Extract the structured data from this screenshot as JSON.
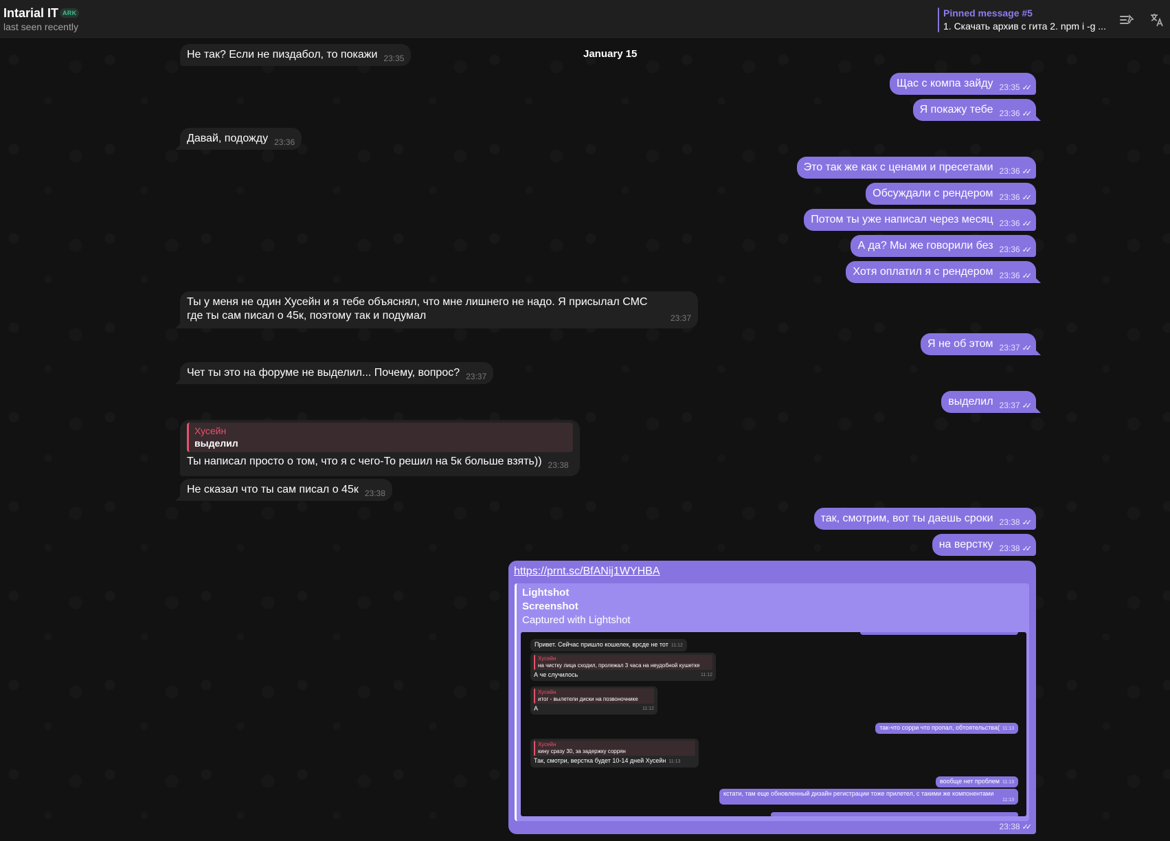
{
  "header": {
    "name": "Intarial IT",
    "badge": "ARK",
    "status": "last seen recently",
    "pinned_title": "Pinned message #5",
    "pinned_text": "1. Скачать архив с гита 2. npm i -g ..."
  },
  "date_separator": "January 15",
  "messages": {
    "m1": {
      "text": "Не так? Если не пиздабол, то покажи",
      "time": "23:35"
    },
    "m2": {
      "text": "Щас с компа зайду",
      "time": "23:35"
    },
    "m3": {
      "text": "Я покажу тебе",
      "time": "23:36"
    },
    "m4": {
      "text": "Давай, подожду",
      "time": "23:36"
    },
    "m5": {
      "text": "Это так же как с ценами и пресетами",
      "time": "23:36"
    },
    "m6": {
      "text": "Обсуждали с рендером",
      "time": "23:36"
    },
    "m7": {
      "text": "Потом ты уже написал через месяц",
      "time": "23:36"
    },
    "m8": {
      "text": "А да? Мы же говорили без",
      "time": "23:36"
    },
    "m9": {
      "text": "Хотя оплатил я с рендером",
      "time": "23:36"
    },
    "m10": {
      "text": "Ты у меня не один Хусейн и я тебе объяснял, что мне лишнего не надо. Я присылал СМС где ты сам писал о 45к, поэтому так и подумал",
      "time": "23:37"
    },
    "m11": {
      "text": "Я не об этом",
      "time": "23:37"
    },
    "m12": {
      "text": "Чет ты это на форуме не выделил... Почему, вопрос?",
      "time": "23:37"
    },
    "m13": {
      "text": "выделил",
      "time": "23:37"
    },
    "m14": {
      "reply_name": "Хусейн",
      "reply_text": "выделил",
      "text": "Ты написал просто о том, что я с чего-То решил на 5к больше взять))",
      "time": "23:38"
    },
    "m15": {
      "text": "Не сказал что ты сам писал о 45к",
      "time": "23:38"
    },
    "m16": {
      "text": "так, смотрим, вот ты даешь сроки",
      "time": "23:38"
    },
    "m17": {
      "text": "на верстку",
      "time": "23:38"
    }
  },
  "link_message": {
    "url": "https://prnt.sc/BfANij1WYHBA",
    "site": "Lightshot",
    "title": "Screenshot",
    "description": "Captured with Lightshot",
    "time": "23:38",
    "screenshot": {
      "s1": {
        "text": "Привет. Сейчас пришло кошелек, врсде не тот",
        "time": "11:12"
      },
      "s2": {
        "reply_name": "Хусейн",
        "reply_text": "на чистку лица сходил, пролежал 3 часа на неудобной кушетке",
        "text": "А че случилось",
        "time": "11:12"
      },
      "s3": {
        "reply_name": "Хусейн",
        "reply_text": "итог - вылетели диски на позвоночнике",
        "text": "А",
        "time": "11:12"
      },
      "s4": {
        "text": "так-что сорри что пропал, обтоятельства(",
        "time": "11:13"
      },
      "s5": {
        "reply_name": "Хусейн",
        "reply_text": "кину сразу 30, за задержку соррян",
        "text": "Так, смотри, верстка будет 10-14 дней Хусейн",
        "time": "11:13"
      },
      "s6": {
        "text": "вообще нет проблем",
        "time": "11:13"
      },
      "s7": {
        "text": "кстати, там еще обновленный дизайн регистрации тоже прилетел, с такими же компонентами",
        "time": "11:13"
      }
    }
  },
  "icons": {
    "pinned_list": "pinned-list-icon",
    "translate": "translate-icon",
    "read_checks": "double-check-icon"
  },
  "colors": {
    "outgoing": "#8774e1",
    "incoming": "#212121",
    "reply_accent": "#e6526b",
    "header": "#1f1f1f"
  }
}
